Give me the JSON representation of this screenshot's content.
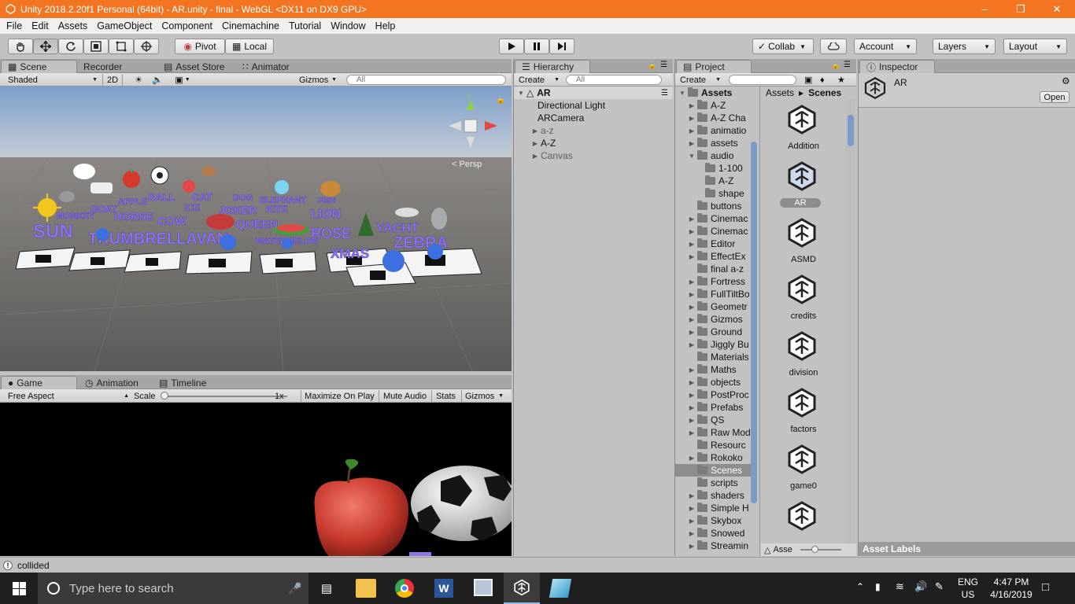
{
  "title": "Unity 2018.2.20f1 Personal (64bit) - AR.unity - final - WebGL <DX11 on DX9 GPU>",
  "menu": [
    "File",
    "Edit",
    "Assets",
    "GameObject",
    "Component",
    "Cinemachine",
    "Tutorial",
    "Window",
    "Help"
  ],
  "toolbar": {
    "pivot": "Pivot",
    "local": "Local",
    "collab": "Collab",
    "account": "Account",
    "layers": "Layers",
    "layout": "Layout"
  },
  "scene": {
    "tabs": [
      "Scene",
      "Recorder",
      "Asset Store",
      "Animator"
    ],
    "shading": "Shaded",
    "mode2d": "2D",
    "gizmos": "Gizmos",
    "search": "All",
    "persp": "Persp",
    "labels": [
      "SUN",
      "TRUMBRELLAVAN",
      "LION",
      "YACHT",
      "ZEBRA",
      "XMAS",
      "ROSE",
      "BALL",
      "CAT",
      "DOG",
      "ELEPHANT",
      "GOAT",
      "HORSE",
      "APPLE",
      "FISH",
      "ICE",
      "JOKER",
      "KITE",
      "QUEEN",
      "WATERMELON",
      "MONKEY",
      "COW"
    ]
  },
  "game": {
    "tabs": [
      "Game",
      "Animation",
      "Timeline"
    ],
    "aspect": "Free Aspect",
    "scale_label": "Scale",
    "scale_value": "1x",
    "buttons": [
      "Maximize On Play",
      "Mute Audio",
      "Stats",
      "Gizmos"
    ]
  },
  "hierarchy": {
    "tab": "Hierarchy",
    "create": "Create",
    "search": "All",
    "root": "AR",
    "items": [
      {
        "name": "Directional Light",
        "indent": 2,
        "arrow": false,
        "grey": false
      },
      {
        "name": "ARCamera",
        "indent": 2,
        "arrow": false,
        "grey": false
      },
      {
        "name": "a-z",
        "indent": 1,
        "arrow": true,
        "grey": true
      },
      {
        "name": "A-Z",
        "indent": 1,
        "arrow": true,
        "grey": false
      },
      {
        "name": "Canvas",
        "indent": 1,
        "arrow": true,
        "grey": true
      }
    ]
  },
  "project": {
    "tab": "Project",
    "create": "Create",
    "root": "Assets",
    "breadcrumb": [
      "Assets",
      "Scenes"
    ],
    "folders": [
      {
        "name": "A-Z",
        "level": 1,
        "arrow": "right"
      },
      {
        "name": "A-Z Cha",
        "level": 1,
        "arrow": "right"
      },
      {
        "name": "animatio",
        "level": 1,
        "arrow": "right"
      },
      {
        "name": "assets",
        "level": 1,
        "arrow": "right"
      },
      {
        "name": "audio",
        "level": 1,
        "arrow": "down"
      },
      {
        "name": "1-100",
        "level": 2,
        "arrow": ""
      },
      {
        "name": "A-Z",
        "level": 2,
        "arrow": ""
      },
      {
        "name": "shape",
        "level": 2,
        "arrow": ""
      },
      {
        "name": "buttons",
        "level": 1,
        "arrow": ""
      },
      {
        "name": "Cinemac",
        "level": 1,
        "arrow": "right"
      },
      {
        "name": "Cinemac",
        "level": 1,
        "arrow": "right"
      },
      {
        "name": "Editor",
        "level": 1,
        "arrow": "right"
      },
      {
        "name": "EffectEx",
        "level": 1,
        "arrow": "right"
      },
      {
        "name": "final a-z",
        "level": 1,
        "arrow": ""
      },
      {
        "name": "Fortress",
        "level": 1,
        "arrow": "right"
      },
      {
        "name": "FullTiltBo",
        "level": 1,
        "arrow": "right"
      },
      {
        "name": "Geometr",
        "level": 1,
        "arrow": "right"
      },
      {
        "name": "Gizmos",
        "level": 1,
        "arrow": "right"
      },
      {
        "name": "Ground",
        "level": 1,
        "arrow": "right"
      },
      {
        "name": "Jiggly Bu",
        "level": 1,
        "arrow": "right"
      },
      {
        "name": "Materials",
        "level": 1,
        "arrow": ""
      },
      {
        "name": "Maths",
        "level": 1,
        "arrow": "right"
      },
      {
        "name": "objects",
        "level": 1,
        "arrow": "right"
      },
      {
        "name": "PostProc",
        "level": 1,
        "arrow": "right"
      },
      {
        "name": "Prefabs",
        "level": 1,
        "arrow": "right"
      },
      {
        "name": "QS",
        "level": 1,
        "arrow": "right"
      },
      {
        "name": "Raw Mod",
        "level": 1,
        "arrow": "right"
      },
      {
        "name": "Resourc",
        "level": 1,
        "arrow": ""
      },
      {
        "name": "Rokoko",
        "level": 1,
        "arrow": "right"
      },
      {
        "name": "Scenes",
        "level": 1,
        "arrow": "",
        "selected": true
      },
      {
        "name": "scripts",
        "level": 1,
        "arrow": ""
      },
      {
        "name": "shaders",
        "level": 1,
        "arrow": "right"
      },
      {
        "name": "Simple H",
        "level": 1,
        "arrow": "right"
      },
      {
        "name": "Skybox",
        "level": 1,
        "arrow": "right"
      },
      {
        "name": "Snowed",
        "level": 1,
        "arrow": "right"
      },
      {
        "name": "Streamin",
        "level": 1,
        "arrow": "right"
      }
    ],
    "scenes": [
      "Addition",
      "AR",
      "ASMD",
      "credits",
      "division",
      "factors",
      "game0",
      ""
    ],
    "footer": "Asse"
  },
  "inspector": {
    "tab": "Inspector",
    "object": "AR",
    "open": "Open",
    "asset_labels": "Asset Labels"
  },
  "status": "collided",
  "taskbar": {
    "search": "Type here to search",
    "lang1": "ENG",
    "lang2": "US",
    "time": "4:47 PM",
    "date": "4/16/2019"
  },
  "colors": {
    "title": "#f47521",
    "selection": "#3e7de0",
    "scene_sky": "#8fb0d9",
    "ground": "#6b6866"
  }
}
